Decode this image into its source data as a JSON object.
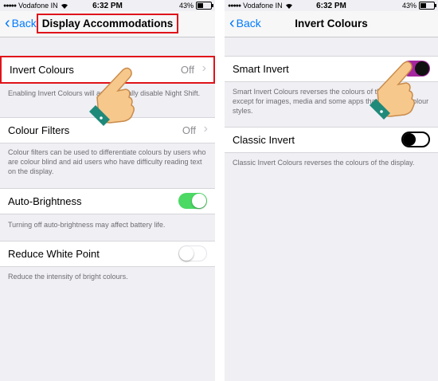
{
  "left": {
    "status": {
      "carrier": "Vodafone IN",
      "time": "6:32 PM",
      "battery": "43%"
    },
    "nav": {
      "back_label": "Back",
      "title": "Display Accommodations"
    },
    "cells": [
      {
        "label": "Invert Colours",
        "value": "Off"
      },
      {
        "label": "Colour Filters",
        "value": "Off"
      },
      {
        "label": "Auto-Brightness",
        "toggle": "on"
      },
      {
        "label": "Reduce White Point",
        "toggle": "off"
      }
    ],
    "footers": [
      "Enabling Invert Colours will automatically disable Night Shift.",
      "Colour filters can be used to differentiate colours by users who are colour blind and aid users who have difficulty reading text on the display.",
      "Turning off auto-brightness may affect battery life.",
      "Reduce the intensity of bright colours."
    ]
  },
  "right": {
    "status": {
      "carrier": "Vodafone IN",
      "time": "6:32 PM",
      "battery": "43%"
    },
    "nav": {
      "back_label": "Back",
      "title": "Invert Colours"
    },
    "cells": [
      {
        "label": "Smart Invert",
        "toggle": "on"
      },
      {
        "label": "Classic Invert",
        "toggle": "off"
      }
    ],
    "footers": [
      "Smart Invert Colours reverses the colours of the display, except for images, media and some apps that use dark colour styles.",
      "Classic Invert Colours reverses the colours of the display."
    ]
  },
  "colors": {
    "accent": "#007aff",
    "highlight": "#e0131a",
    "toggle_on": "#4cd964",
    "smart_invert_toggle": "#a5269e"
  },
  "icons": [
    "wifi-icon",
    "signal-icon",
    "battery-icon",
    "back-chevron-icon",
    "chevron-right-icon",
    "pointing-hand-icon"
  ]
}
